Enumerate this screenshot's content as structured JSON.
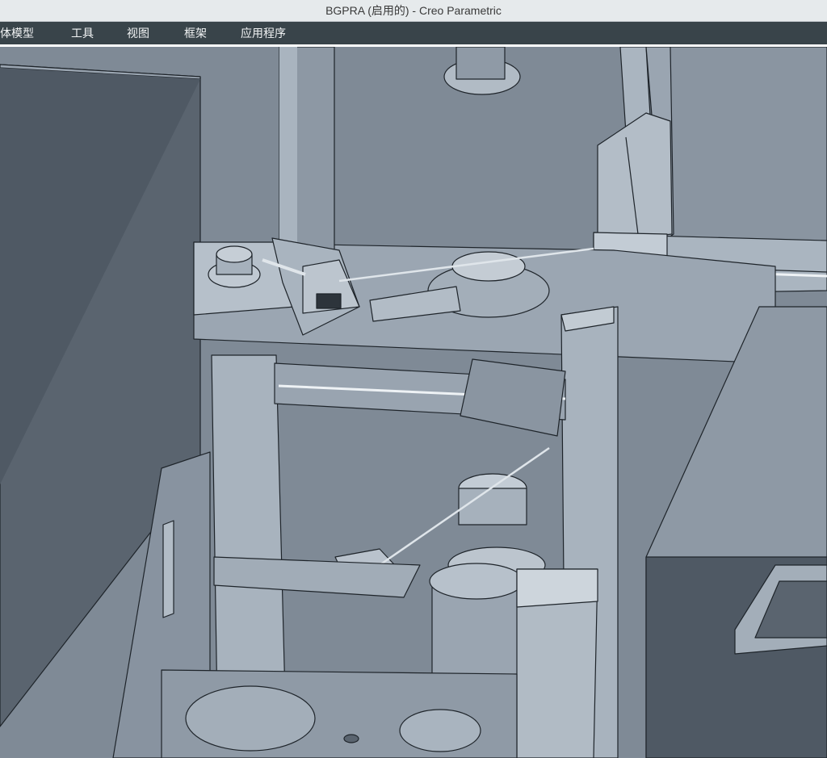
{
  "window": {
    "title": "BGPRA (启用的) - Creo Parametric"
  },
  "menu": {
    "items": [
      {
        "label": "人体模型"
      },
      {
        "label": "工具"
      },
      {
        "label": "视图"
      },
      {
        "label": "框架"
      },
      {
        "label": "应用程序"
      }
    ]
  },
  "colors": {
    "title_bg": "#e6eaec",
    "menubar_bg": "#39444a",
    "model_face_light": "#a9b4bf",
    "model_face_mid": "#8e99a5",
    "model_face_dark": "#5a646f",
    "edge": "#1e242a"
  }
}
